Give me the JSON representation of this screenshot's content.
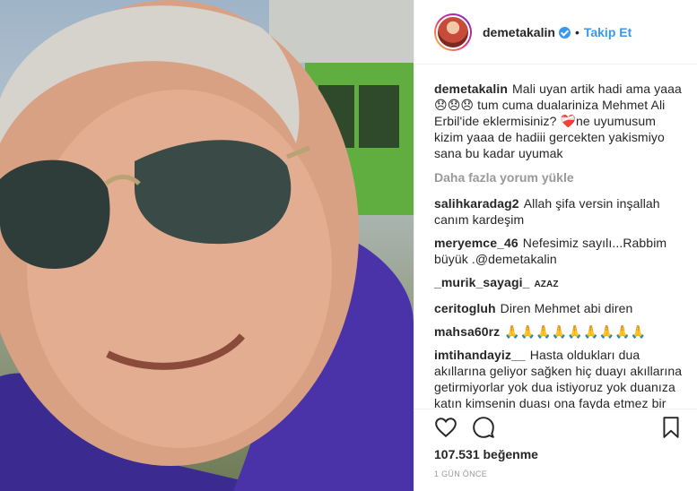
{
  "post": {
    "username": "demetakalin",
    "verified": true,
    "follow_label": "Takip Et",
    "separator": "•",
    "caption": {
      "user": "demetakalin",
      "text": "Mali uyan artik hadi ama yaaa 😞😞😞 tum cuma dualariniza Mehmet Ali Erbil'ide eklermisiniz? ❤️‍🩹ne uyumusum kizim yaaa de hadiii gercekten yakismiyo sana bu kadar uyumak"
    },
    "load_more_label": "Daha fazla yorum yükle",
    "comments": [
      {
        "user": "salihkaradag2",
        "text": "Allah şifa versin inşallah canım kardeşim"
      },
      {
        "user": "meryemce_46",
        "text": "Nefesimiz sayılı...Rabbim büyük .@demetakalin"
      },
      {
        "user": "_murik_sayagi_",
        "text": "AZAZ"
      },
      {
        "user": "ceritogluh",
        "text": "Diren Mehmet abi diren"
      },
      {
        "user": "mahsa60rz",
        "text": "🙏🙏🙏🙏🙏🙏🙏🙏🙏"
      },
      {
        "user": "imtihandayiz__",
        "text": "Hasta oldukları dua akıllarına geliyor sağken hiç duayı akıllarına getirmiyorlar yok dua istiyoruz yok duanıza katın kimsenin duası ona fayda etmez bir soytari ölmüsse çok iş olmuş ne faydası"
      }
    ],
    "likes_count": "107.531",
    "likes_suffix": "beğenme",
    "timestamp": "1 GÜN ÖNCE"
  },
  "icons": {
    "like": "heart-icon",
    "comment": "comment-icon",
    "share": "share-icon",
    "save": "bookmark-icon",
    "verified": "verified-badge-icon"
  },
  "colors": {
    "link": "#3897f0",
    "text": "#262626",
    "muted": "#999999",
    "border": "#efefef"
  }
}
